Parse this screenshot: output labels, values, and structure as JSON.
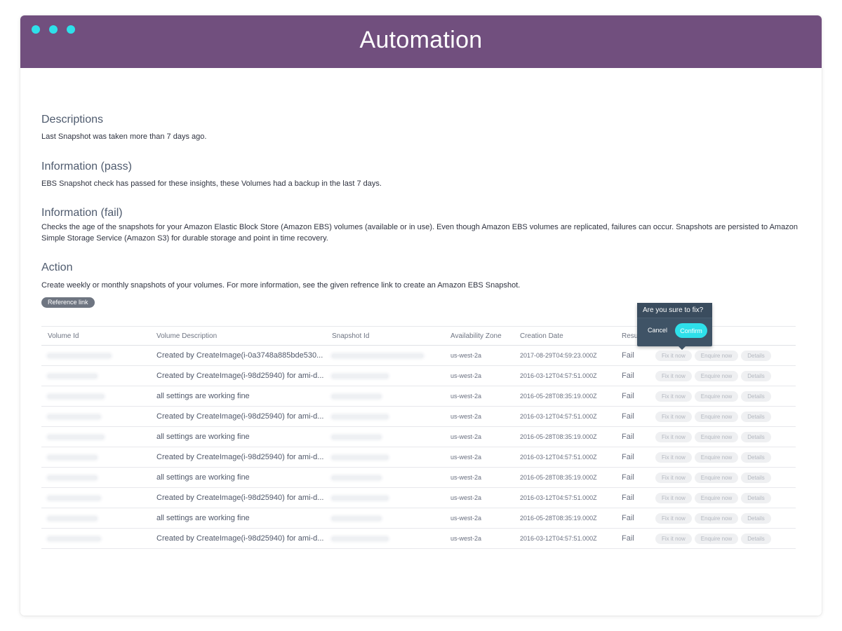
{
  "window": {
    "title": "Automation"
  },
  "sections": {
    "descriptions": {
      "heading": "Descriptions",
      "text": "Last Snapshot was taken more than 7 days ago."
    },
    "info_pass": {
      "heading": "Information (pass)",
      "text": "EBS Snapshot check has passed for these insights, these Volumes had a backup in the last 7 days."
    },
    "info_fail": {
      "heading": "Information (fail)",
      "text": "Checks the age of the snapshots for your Amazon Elastic Block Store (Amazon EBS) volumes (available or in use). Even though Amazon EBS volumes are replicated, failures can occur. Snapshots are persisted to Amazon Simple Storage Service (Amazon S3) for durable storage and point in time recovery."
    },
    "action": {
      "heading": "Action",
      "text": "Create weekly or monthly snapshots of your volumes. For more information, see the given refrence link to create an Amazon EBS Snapshot."
    }
  },
  "reference_link": "Reference link",
  "table": {
    "headers": {
      "volume_id": "Volume Id",
      "description": "Volume Description",
      "snapshot_id": "Snapshot Id",
      "zone": "Availability Zone",
      "date": "Creation Date",
      "result": "Resul"
    },
    "rows": [
      {
        "description": "Created by CreateImage(i-0a3748a885bde530...",
        "zone": "us-west-2a",
        "date": "2017-08-29T04:59:23.000Z",
        "result": "Fail"
      },
      {
        "description": "Created by CreateImage(i-98d25940) for ami-d...",
        "zone": "us-west-2a",
        "date": "2016-03-12T04:57:51.000Z",
        "result": "Fail"
      },
      {
        "description": "all settings are working fine",
        "zone": "us-west-2a",
        "date": "2016-05-28T08:35:19.000Z",
        "result": "Fail"
      },
      {
        "description": "Created by CreateImage(i-98d25940) for ami-d...",
        "zone": "us-west-2a",
        "date": "2016-03-12T04:57:51.000Z",
        "result": "Fail"
      },
      {
        "description": "all settings are working fine",
        "zone": "us-west-2a",
        "date": "2016-05-28T08:35:19.000Z",
        "result": "Fail"
      },
      {
        "description": "Created by CreateImage(i-98d25940) for ami-d...",
        "zone": "us-west-2a",
        "date": "2016-03-12T04:57:51.000Z",
        "result": "Fail"
      },
      {
        "description": "all settings are working fine",
        "zone": "us-west-2a",
        "date": "2016-05-28T08:35:19.000Z",
        "result": "Fail"
      },
      {
        "description": "Created by CreateImage(i-98d25940) for ami-d...",
        "zone": "us-west-2a",
        "date": "2016-03-12T04:57:51.000Z",
        "result": "Fail"
      },
      {
        "description": "all settings are working fine",
        "zone": "us-west-2a",
        "date": "2016-05-28T08:35:19.000Z",
        "result": "Fail"
      },
      {
        "description": "Created by CreateImage(i-98d25940) for ami-d...",
        "zone": "us-west-2a",
        "date": "2016-03-12T04:57:51.000Z",
        "result": "Fail"
      }
    ],
    "actions": {
      "fix": "Fix it now",
      "enquire": "Enquire now",
      "details": "Details"
    }
  },
  "popover": {
    "question": "Are you sure to fix?",
    "cancel": "Cancel",
    "confirm": "Confirm"
  },
  "colors": {
    "titlebar": "#714f7e",
    "accent": "#2ee0ea",
    "popover": "#3f5366"
  }
}
